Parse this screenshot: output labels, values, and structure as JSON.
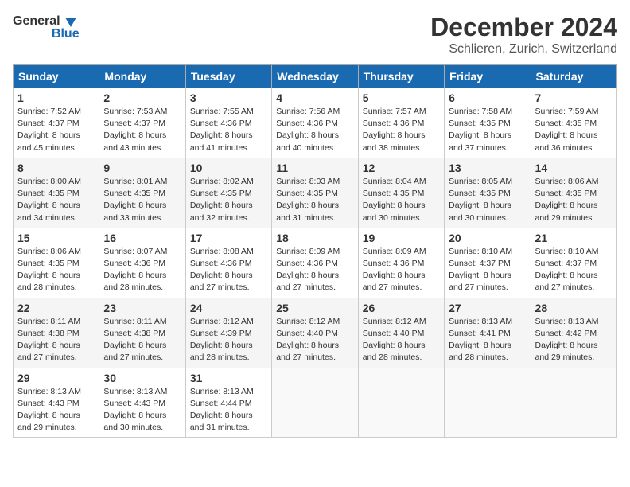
{
  "header": {
    "logo_general": "General",
    "logo_blue": "Blue",
    "month": "December 2024",
    "location": "Schlieren, Zurich, Switzerland"
  },
  "columns": [
    "Sunday",
    "Monday",
    "Tuesday",
    "Wednesday",
    "Thursday",
    "Friday",
    "Saturday"
  ],
  "weeks": [
    [
      {
        "day": "1",
        "sunrise": "7:52 AM",
        "sunset": "4:37 PM",
        "daylight": "8 hours and 45 minutes."
      },
      {
        "day": "2",
        "sunrise": "7:53 AM",
        "sunset": "4:37 PM",
        "daylight": "8 hours and 43 minutes."
      },
      {
        "day": "3",
        "sunrise": "7:55 AM",
        "sunset": "4:36 PM",
        "daylight": "8 hours and 41 minutes."
      },
      {
        "day": "4",
        "sunrise": "7:56 AM",
        "sunset": "4:36 PM",
        "daylight": "8 hours and 40 minutes."
      },
      {
        "day": "5",
        "sunrise": "7:57 AM",
        "sunset": "4:36 PM",
        "daylight": "8 hours and 38 minutes."
      },
      {
        "day": "6",
        "sunrise": "7:58 AM",
        "sunset": "4:35 PM",
        "daylight": "8 hours and 37 minutes."
      },
      {
        "day": "7",
        "sunrise": "7:59 AM",
        "sunset": "4:35 PM",
        "daylight": "8 hours and 36 minutes."
      }
    ],
    [
      {
        "day": "8",
        "sunrise": "8:00 AM",
        "sunset": "4:35 PM",
        "daylight": "8 hours and 34 minutes."
      },
      {
        "day": "9",
        "sunrise": "8:01 AM",
        "sunset": "4:35 PM",
        "daylight": "8 hours and 33 minutes."
      },
      {
        "day": "10",
        "sunrise": "8:02 AM",
        "sunset": "4:35 PM",
        "daylight": "8 hours and 32 minutes."
      },
      {
        "day": "11",
        "sunrise": "8:03 AM",
        "sunset": "4:35 PM",
        "daylight": "8 hours and 31 minutes."
      },
      {
        "day": "12",
        "sunrise": "8:04 AM",
        "sunset": "4:35 PM",
        "daylight": "8 hours and 30 minutes."
      },
      {
        "day": "13",
        "sunrise": "8:05 AM",
        "sunset": "4:35 PM",
        "daylight": "8 hours and 30 minutes."
      },
      {
        "day": "14",
        "sunrise": "8:06 AM",
        "sunset": "4:35 PM",
        "daylight": "8 hours and 29 minutes."
      }
    ],
    [
      {
        "day": "15",
        "sunrise": "8:06 AM",
        "sunset": "4:35 PM",
        "daylight": "8 hours and 28 minutes."
      },
      {
        "day": "16",
        "sunrise": "8:07 AM",
        "sunset": "4:36 PM",
        "daylight": "8 hours and 28 minutes."
      },
      {
        "day": "17",
        "sunrise": "8:08 AM",
        "sunset": "4:36 PM",
        "daylight": "8 hours and 27 minutes."
      },
      {
        "day": "18",
        "sunrise": "8:09 AM",
        "sunset": "4:36 PM",
        "daylight": "8 hours and 27 minutes."
      },
      {
        "day": "19",
        "sunrise": "8:09 AM",
        "sunset": "4:36 PM",
        "daylight": "8 hours and 27 minutes."
      },
      {
        "day": "20",
        "sunrise": "8:10 AM",
        "sunset": "4:37 PM",
        "daylight": "8 hours and 27 minutes."
      },
      {
        "day": "21",
        "sunrise": "8:10 AM",
        "sunset": "4:37 PM",
        "daylight": "8 hours and 27 minutes."
      }
    ],
    [
      {
        "day": "22",
        "sunrise": "8:11 AM",
        "sunset": "4:38 PM",
        "daylight": "8 hours and 27 minutes."
      },
      {
        "day": "23",
        "sunrise": "8:11 AM",
        "sunset": "4:38 PM",
        "daylight": "8 hours and 27 minutes."
      },
      {
        "day": "24",
        "sunrise": "8:12 AM",
        "sunset": "4:39 PM",
        "daylight": "8 hours and 28 minutes."
      },
      {
        "day": "25",
        "sunrise": "8:12 AM",
        "sunset": "4:40 PM",
        "daylight": "8 hours and 27 minutes."
      },
      {
        "day": "26",
        "sunrise": "8:12 AM",
        "sunset": "4:40 PM",
        "daylight": "8 hours and 28 minutes."
      },
      {
        "day": "27",
        "sunrise": "8:13 AM",
        "sunset": "4:41 PM",
        "daylight": "8 hours and 28 minutes."
      },
      {
        "day": "28",
        "sunrise": "8:13 AM",
        "sunset": "4:42 PM",
        "daylight": "8 hours and 29 minutes."
      }
    ],
    [
      {
        "day": "29",
        "sunrise": "8:13 AM",
        "sunset": "4:43 PM",
        "daylight": "8 hours and 29 minutes."
      },
      {
        "day": "30",
        "sunrise": "8:13 AM",
        "sunset": "4:43 PM",
        "daylight": "8 hours and 30 minutes."
      },
      {
        "day": "31",
        "sunrise": "8:13 AM",
        "sunset": "4:44 PM",
        "daylight": "8 hours and 31 minutes."
      },
      null,
      null,
      null,
      null
    ]
  ]
}
